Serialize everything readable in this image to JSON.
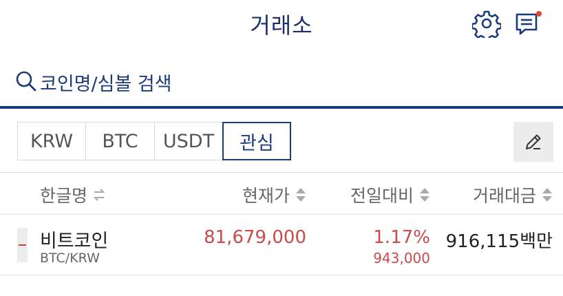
{
  "header": {
    "title": "거래소"
  },
  "search": {
    "placeholder": "코인명/심볼 검색"
  },
  "tabs": [
    {
      "label": "KRW",
      "active": false
    },
    {
      "label": "BTC",
      "active": false
    },
    {
      "label": "USDT",
      "active": false
    },
    {
      "label": "관심",
      "active": true
    }
  ],
  "columns": {
    "name": "한글명",
    "price": "현재가",
    "change": "전일대비",
    "volume": "거래대금"
  },
  "rows": [
    {
      "name": "비트코인",
      "symbol": "BTC/KRW",
      "price": "81,679,000",
      "change_pct": "1.17%",
      "change_amt": "943,000",
      "volume": "916,115백만"
    }
  ],
  "colors": {
    "brand": "#1a3a7c",
    "rise": "#c84a4a",
    "notification": "#e5452f"
  },
  "icons": [
    "gear-icon",
    "chat-icon",
    "search-icon",
    "pencil-icon",
    "swap-icon",
    "sort-icon"
  ]
}
